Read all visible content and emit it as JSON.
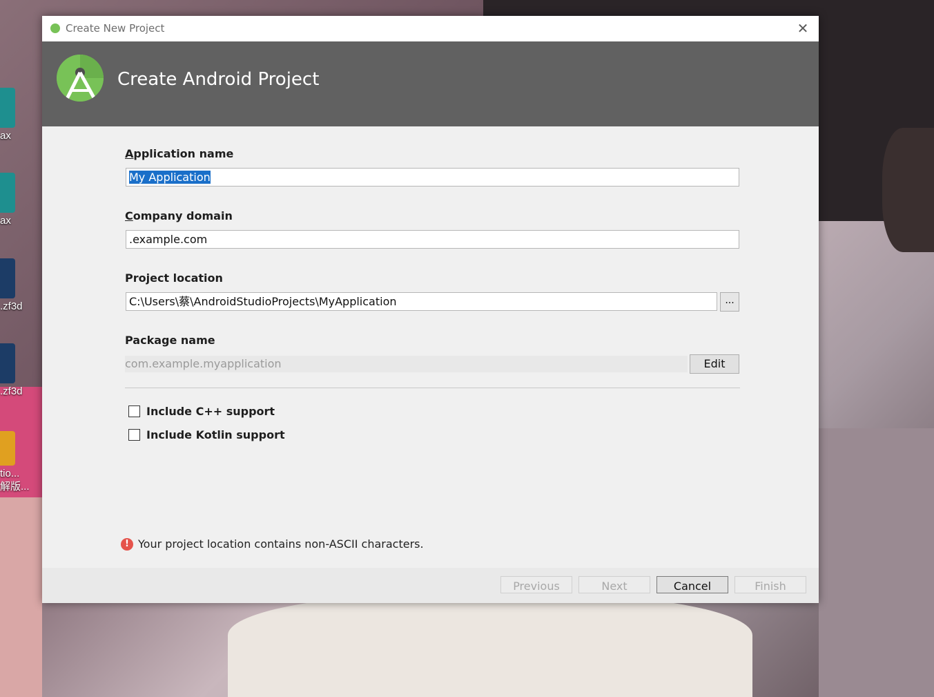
{
  "desktop": {
    "icons": [
      {
        "label": "ax",
        "icon": "3dsmax-icon",
        "color": "#1e8f8f"
      },
      {
        "label": "ax",
        "icon": "3dsmax-icon",
        "color": "#1e8f8f"
      },
      {
        "label": ".zf3d",
        "icon": "zf3d-icon",
        "color": "#1c3c66"
      },
      {
        "label": ".zf3d",
        "icon": "zf3d-icon",
        "color": "#1c3c66"
      },
      {
        "label": "tio...",
        "label2": "解版...",
        "icon": "archive-icon",
        "color": "#e0a020"
      }
    ]
  },
  "dialog": {
    "window_title": "Create New Project",
    "close_glyph": "✕",
    "heading": "Create Android Project",
    "app_name": {
      "label_accel": "A",
      "label_rest": "pplication name",
      "value": "My Application"
    },
    "company_domain": {
      "label_accel": "C",
      "label_rest": "ompany domain",
      "value": ".example.com"
    },
    "project_location": {
      "label": "Project location",
      "value": "C:\\Users\\蔡\\AndroidStudioProjects\\MyApplication",
      "browse_label": "..."
    },
    "package_name": {
      "label": "Package name",
      "value": "com.example.myapplication",
      "edit_label": "Edit"
    },
    "options": [
      {
        "label": "Include C++ support",
        "checked": false
      },
      {
        "label": "Include Kotlin support",
        "checked": false
      }
    ],
    "warning": {
      "icon": "error-icon",
      "glyph": "!",
      "text": "Your project location contains non-ASCII characters."
    },
    "buttons": {
      "previous": "Previous",
      "next": "Next",
      "cancel": "Cancel",
      "finish": "Finish"
    }
  },
  "colors": {
    "banner": "#616161",
    "android_green": "#78c257",
    "selection": "#1a6fc9",
    "error": "#e5534b"
  }
}
